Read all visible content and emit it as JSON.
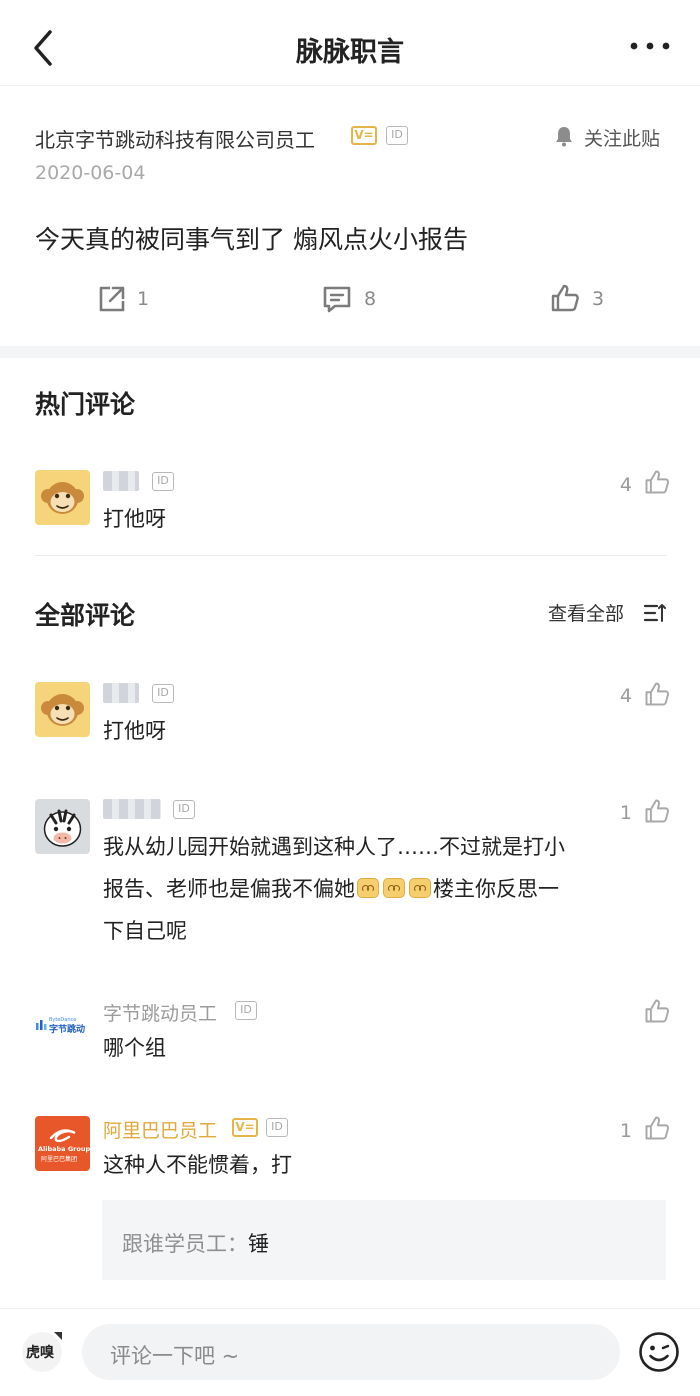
{
  "nav": {
    "title": "脉脉职言"
  },
  "post": {
    "author": "北京字节跳动科技有限公司员工",
    "verified_badge": "V=",
    "id_badge": "ID",
    "follow_label": "关注此贴",
    "date": "2020-06-04",
    "body": "今天真的被同事气到了 煽风点火小报告",
    "share_count": "1",
    "comment_count": "8",
    "like_count": "3"
  },
  "hot": {
    "title": "热门评论",
    "comments": [
      {
        "id_badge": "ID",
        "text": "打他呀",
        "likes": "4"
      }
    ]
  },
  "all": {
    "title": "全部评论",
    "view_all": "查看全部",
    "comments": [
      {
        "id_badge": "ID",
        "text": "打他呀",
        "likes": "4"
      },
      {
        "id_badge": "ID",
        "text_a": "我从幼儿园开始就遇到这种人了……不过就是打小",
        "text_b": "报告、老师也是偏我不偏她",
        "text_c": "楼主你反思一",
        "text_d": "下自己呢",
        "likes": "1"
      },
      {
        "name": "字节跳动员工",
        "id_badge": "ID",
        "logo_text": "字节跳动",
        "logo_small": "ByteDance",
        "text": "哪个组",
        "likes": ""
      },
      {
        "name": "阿里巴巴员工",
        "verified_badge": "V=",
        "id_badge": "ID",
        "logo_text": "Alibaba Group",
        "logo_cn": "阿里巴巴集团",
        "text": "这种人不能惯着，打",
        "likes": "1",
        "reply": {
          "author": "跟谁学员工：",
          "text": "锤"
        }
      }
    ]
  },
  "bottom": {
    "placeholder": "评论一下吧 ~",
    "watermark": "虎嗅"
  },
  "colors": {
    "gold": "#e1a83b",
    "alibaba_orange": "#e8572a",
    "divider": "#ececec"
  },
  "icons": [
    "back-icon",
    "more-icon",
    "bell-icon",
    "share-icon",
    "comment-icon",
    "thumb-up-icon",
    "sort-icon",
    "smile-icon"
  ]
}
